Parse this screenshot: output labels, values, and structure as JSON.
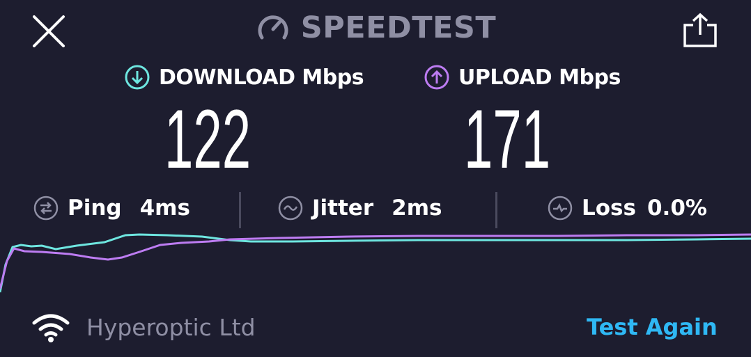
{
  "header": {
    "title": "SPEEDTEST",
    "close_icon": "close-icon",
    "gauge_icon": "speedometer-icon",
    "share_icon": "share-icon"
  },
  "download": {
    "label": "DOWNLOAD Mbps",
    "value": "122",
    "icon": "download-arrow-icon",
    "color": "#6ee6e0"
  },
  "upload": {
    "label": "UPLOAD Mbps",
    "value": "171",
    "icon": "upload-arrow-icon",
    "color": "#bd7cf2"
  },
  "stats": {
    "ping": {
      "label": "Ping",
      "value": "4ms",
      "icon": "ping-icon"
    },
    "jitter": {
      "label": "Jitter",
      "value": "2ms",
      "icon": "jitter-icon"
    },
    "loss": {
      "label": "Loss",
      "value": "0.0%",
      "icon": "loss-icon"
    }
  },
  "footer": {
    "isp": "Hyperoptic Ltd",
    "wifi_icon": "wifi-icon",
    "test_again": "Test Again"
  },
  "colors": {
    "background": "#1d1d2f",
    "muted": "#8f8fa4",
    "accent": "#2fb8f4",
    "download_line": "#6ee6e0",
    "upload_line": "#bd7cf2"
  }
}
